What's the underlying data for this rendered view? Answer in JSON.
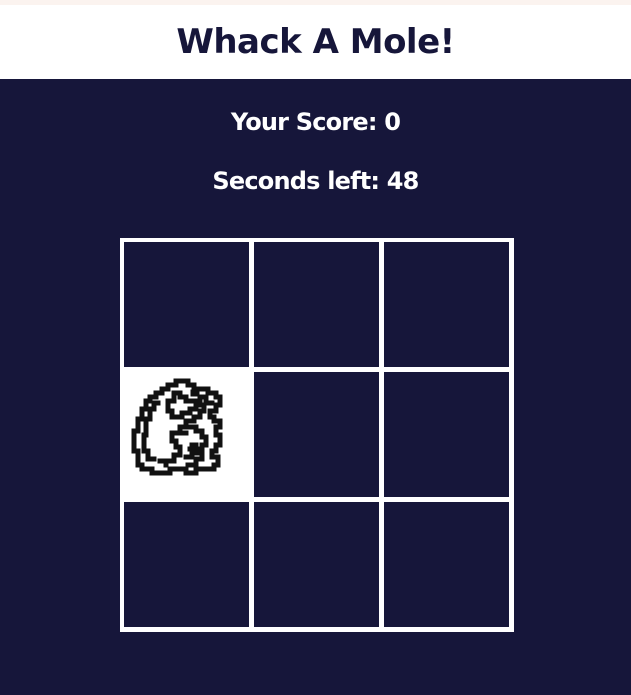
{
  "header": {
    "title": "Whack A Mole!"
  },
  "stats": {
    "score_label": "Your Score: ",
    "score": "0",
    "time_label": "Seconds left: ",
    "time_left": "48"
  },
  "colors": {
    "background": "#16163a",
    "header_background": "#ffffff",
    "grid_lines": "#ffffff",
    "text_light": "#ffffff",
    "text_dark": "#16163a"
  },
  "board": {
    "rows": 3,
    "cols": 3,
    "mole_cell": 3,
    "mole_icon": "mole-icon"
  }
}
